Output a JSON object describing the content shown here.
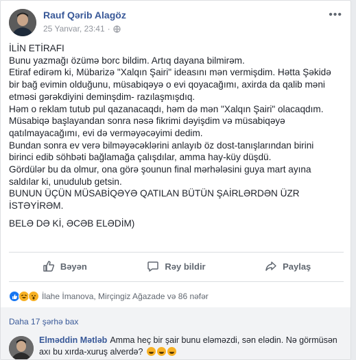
{
  "post": {
    "author": "Rauf Qərib Alagöz",
    "date": "25 Yanvar, 23:41",
    "privacy_icon": "globe-icon",
    "lines": [
      "İLİN ETİRAFI",
      "Bunu yazmağı özümə borc bildim. Artıq dayana bilmirəm.",
      "Etiraf edirəm ki, Mübarizə \"Xalqın Şairi\" ideasını mən vermişdim. Hətta Şəkidə",
      "bir bağ evimin olduğunu, müsabiqəyə o evi qoyacağımı, axirda da qalib məni",
      "etməsi gərəkdiyini deminşdim- razılaşmışdıq.",
      "Həm o reklam tutub pul qazanacaqdı, həm də mən \"Xalqın Şairi\" olacaqdım.",
      "Müsabiqə başlayandan sonra nəsə fikrimi dəyişdim və müsabiqəyə",
      "qatılmayacağımı, evi də verməyəcəyimi dedim.",
      "Bundan sonra ev verə bilməyəcəklərini anlayıb öz dost-tanışlarından birini",
      "birinci edib söhbəti bağlamağa çalışdılar, amma hay-küy düşdü.",
      "Gördülər bu da olmur, ona görə şounun final mərhələsini guya mart ayına",
      "saldılar ki, unudulub getsin.",
      "BUNUN ÜÇÜN MÜSABİQƏYƏ QATILAN BÜTÜN ŞAİRLƏRDƏN ÜZR",
      "İSTƏYİRƏM.",
      "BELƏ DƏ Kİ, ƏCƏB ELƏDİM)"
    ]
  },
  "actions": {
    "like": "Bəyən",
    "comment": "Rəy bildir",
    "share": "Paylaş"
  },
  "reactions": {
    "summary": "İlahe İmanova, Mirçingiz Ağazade və 86 nəfər"
  },
  "comments": {
    "more_label": "Daha 17 şərhə bax",
    "first": {
      "author": "Elməddin Mətləb",
      "text": "Amma heç bir şair bunu eləməzdi, sən elədin. Nə görmüsən axı bu xırda-xuruş alverdə?"
    }
  }
}
